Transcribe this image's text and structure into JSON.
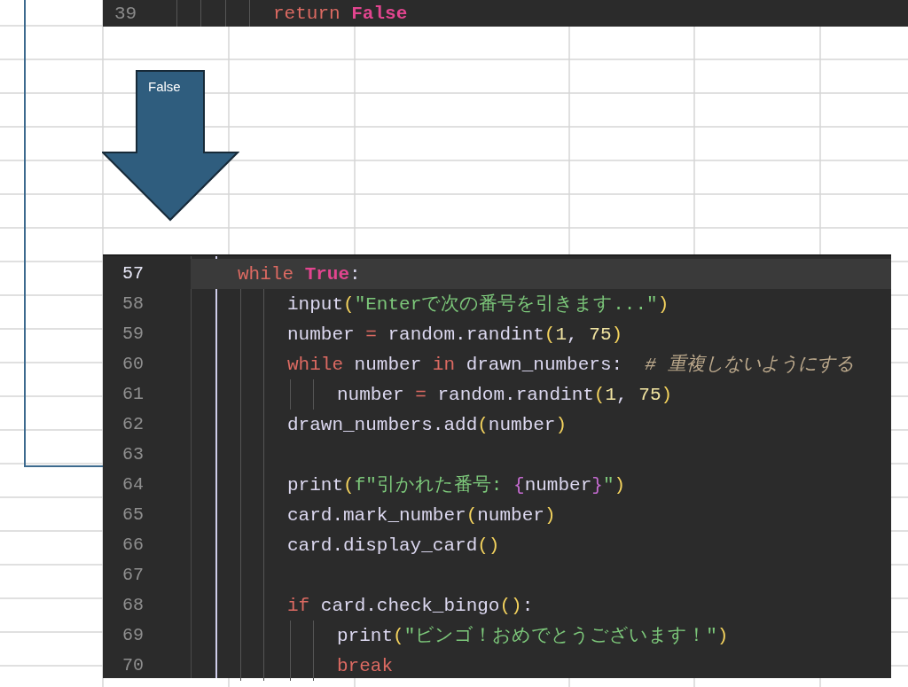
{
  "top_snippet": {
    "number": "39",
    "tokens": [
      {
        "kind": "keyword",
        "text": "return "
      },
      {
        "kind": "constant",
        "text": "False"
      }
    ]
  },
  "arrow": {
    "label": "False"
  },
  "code_block": {
    "lines": [
      {
        "number": "57",
        "current": true,
        "tokens": [
          {
            "kind": "keyword",
            "text": "while "
          },
          {
            "kind": "constant",
            "text": "True"
          },
          {
            "kind": "plain",
            "text": ":"
          }
        ],
        "children": [
          {
            "number": "58",
            "current": false,
            "tokens": [
              {
                "kind": "plain",
                "text": "input"
              },
              {
                "kind": "bracket",
                "text": "("
              },
              {
                "kind": "string",
                "text": "\"Enterで次の番号を引きます...\""
              },
              {
                "kind": "bracket",
                "text": ")"
              }
            ]
          },
          {
            "number": "59",
            "current": false,
            "tokens": [
              {
                "kind": "plain",
                "text": "number "
              },
              {
                "kind": "operator",
                "text": "="
              },
              {
                "kind": "plain",
                "text": " random.randint"
              },
              {
                "kind": "bracket",
                "text": "("
              },
              {
                "kind": "number",
                "text": "1"
              },
              {
                "kind": "plain",
                "text": ", "
              },
              {
                "kind": "number",
                "text": "75"
              },
              {
                "kind": "bracket",
                "text": ")"
              }
            ]
          },
          {
            "number": "60",
            "current": false,
            "tokens": [
              {
                "kind": "keyword",
                "text": "while"
              },
              {
                "kind": "plain",
                "text": " number "
              },
              {
                "kind": "keyword",
                "text": "in"
              },
              {
                "kind": "plain",
                "text": " drawn_numbers:  "
              },
              {
                "kind": "comment",
                "text": "# 重複しないようにする"
              }
            ],
            "children": [
              {
                "number": "61",
                "current": false,
                "tokens": [
                  {
                    "kind": "plain",
                    "text": "number "
                  },
                  {
                    "kind": "operator",
                    "text": "="
                  },
                  {
                    "kind": "plain",
                    "text": " random.randint"
                  },
                  {
                    "kind": "bracket",
                    "text": "("
                  },
                  {
                    "kind": "number",
                    "text": "1"
                  },
                  {
                    "kind": "plain",
                    "text": ", "
                  },
                  {
                    "kind": "number",
                    "text": "75"
                  },
                  {
                    "kind": "bracket",
                    "text": ")"
                  }
                ]
              }
            ]
          },
          {
            "number": "62",
            "current": false,
            "tokens": [
              {
                "kind": "plain",
                "text": "drawn_numbers.add"
              },
              {
                "kind": "bracket",
                "text": "("
              },
              {
                "kind": "plain",
                "text": "number"
              },
              {
                "kind": "bracket",
                "text": ")"
              }
            ]
          },
          {
            "number": "63",
            "current": false
          },
          {
            "number": "64",
            "current": false,
            "tokens": [
              {
                "kind": "plain",
                "text": "print"
              },
              {
                "kind": "bracket",
                "text": "("
              },
              {
                "kind": "string",
                "text": "f\"引かれた番号: "
              },
              {
                "kind": "brace",
                "text": "{"
              },
              {
                "kind": "plain",
                "text": "number"
              },
              {
                "kind": "brace",
                "text": "}"
              },
              {
                "kind": "string",
                "text": "\""
              },
              {
                "kind": "bracket",
                "text": ")"
              }
            ]
          },
          {
            "number": "65",
            "current": false,
            "tokens": [
              {
                "kind": "plain",
                "text": "card.mark_number"
              },
              {
                "kind": "bracket",
                "text": "("
              },
              {
                "kind": "plain",
                "text": "number"
              },
              {
                "kind": "bracket",
                "text": ")"
              }
            ]
          },
          {
            "number": "66",
            "current": false,
            "tokens": [
              {
                "kind": "plain",
                "text": "card.display_card"
              },
              {
                "kind": "bracket",
                "text": "()"
              }
            ]
          },
          {
            "number": "67",
            "current": false
          },
          {
            "number": "68",
            "current": false,
            "tokens": [
              {
                "kind": "keyword",
                "text": "if"
              },
              {
                "kind": "plain",
                "text": " card.check_bingo"
              },
              {
                "kind": "bracket",
                "text": "()"
              },
              {
                "kind": "plain",
                "text": ":"
              }
            ],
            "children": [
              {
                "number": "69",
                "current": false,
                "tokens": [
                  {
                    "kind": "plain",
                    "text": "print"
                  },
                  {
                    "kind": "bracket",
                    "text": "("
                  },
                  {
                    "kind": "string",
                    "text": "\"ビンゴ！おめでとうございます！\""
                  },
                  {
                    "kind": "bracket",
                    "text": ")"
                  }
                ]
              },
              {
                "number": "70",
                "current": false,
                "tokens": [
                  {
                    "kind": "keyword",
                    "text": "break"
                  }
                ]
              }
            ]
          }
        ]
      }
    ]
  }
}
